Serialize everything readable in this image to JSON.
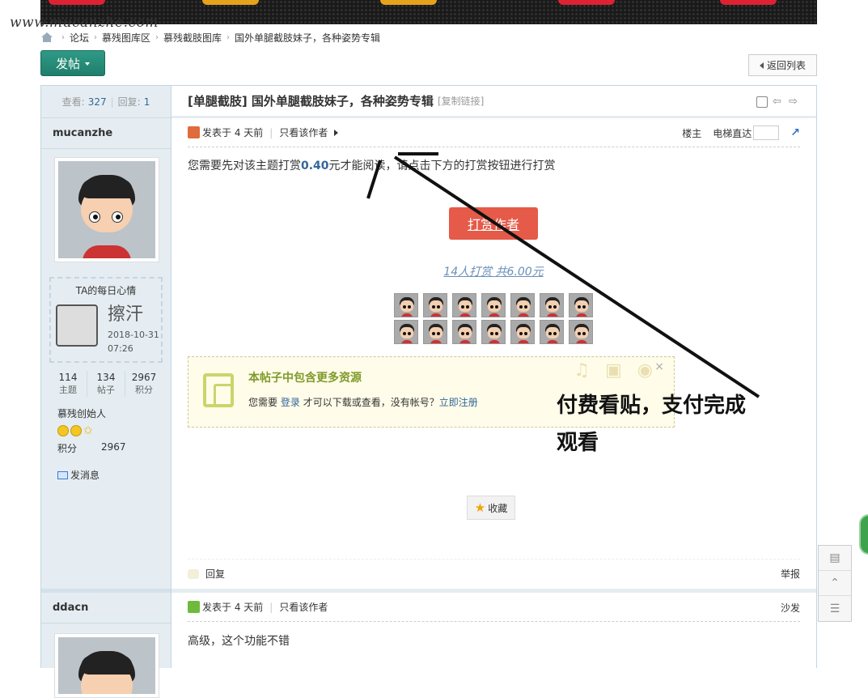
{
  "site": {
    "watermark": "www.mucanzhe.com"
  },
  "breadcrumb": [
    "论坛",
    "慕残图库区",
    "慕残截肢图库",
    "国外单腿截肢妹子，各种姿势专辑"
  ],
  "toolbar": {
    "post_label": "发帖",
    "back_label": "返回列表"
  },
  "thread": {
    "views_label": "查看:",
    "views": "327",
    "replies_label": "回复:",
    "replies": "1",
    "title": "[单腿截肢] 国外单腿截肢妹子，各种姿势专辑",
    "copy_link": "[复制链接]"
  },
  "post1": {
    "author": "mucanzhe",
    "mood_title": "TA的每日心情",
    "mood_text": "擦汗",
    "mood_date": "2018-10-31",
    "mood_time": "07:26",
    "counts": [
      {
        "value": "114",
        "label": "主题"
      },
      {
        "value": "134",
        "label": "帖子"
      },
      {
        "value": "2967",
        "label": "积分"
      }
    ],
    "rank": "慕残创始人",
    "points_label": "积分",
    "points_value": "2967",
    "send_msg": "发消息",
    "posted": "发表于 4 天前",
    "only_author": "只看该作者",
    "floor": "楼主",
    "jump_label": "电梯直达",
    "notice_prefix": "您需要先对该主题打赏",
    "notice_amount": "0.40",
    "notice_suffix": "元才能阅读，请点击下方的打赏按钮进行打赏",
    "reward_button": "打赏作者",
    "reward_summary": "14人打赏  共6.00元",
    "resource_title": "本帖子中包含更多资源",
    "resource_prefix": "您需要",
    "resource_login": "登录",
    "resource_mid": "才可以下载或查看，没有帐号？",
    "resource_register": "立即注册",
    "favorite": "收藏",
    "reply": "回复",
    "report": "举报",
    "accent_color": "#e55a48"
  },
  "post2": {
    "author": "ddacn",
    "posted": "发表于 4 天前",
    "only_author": "只看该作者",
    "floor": "沙发",
    "content": "高级，这个功能不错"
  },
  "annotation": {
    "line1": "付费看贴，支付完成",
    "line2": "观看"
  }
}
